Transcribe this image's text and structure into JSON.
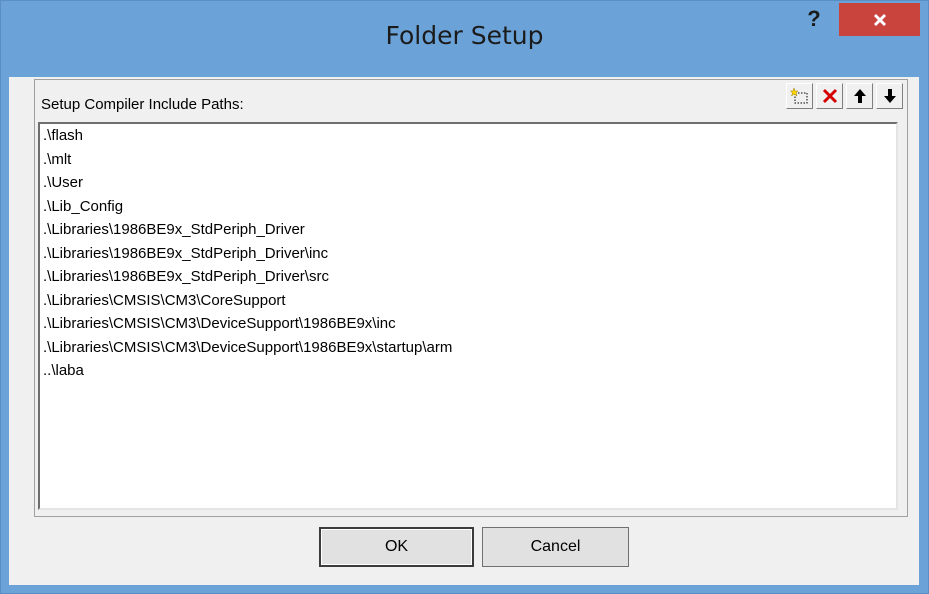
{
  "window": {
    "title": "Folder Setup",
    "help_label": "?"
  },
  "group": {
    "label": "Setup Compiler Include Paths:"
  },
  "toolbar": {
    "icons": [
      "new-folder-icon",
      "delete-icon",
      "move-up-icon",
      "move-down-icon"
    ]
  },
  "paths": [
    ".\\flash",
    ".\\mlt",
    ".\\User",
    ".\\Lib_Config",
    ".\\Libraries\\1986BE9x_StdPeriph_Driver",
    ".\\Libraries\\1986BE9x_StdPeriph_Driver\\inc",
    ".\\Libraries\\1986BE9x_StdPeriph_Driver\\src",
    ".\\Libraries\\CMSIS\\CM3\\CoreSupport",
    ".\\Libraries\\CMSIS\\CM3\\DeviceSupport\\1986BE9x\\inc",
    ".\\Libraries\\CMSIS\\CM3\\DeviceSupport\\1986BE9x\\startup\\arm",
    "..\\laba"
  ],
  "buttons": {
    "ok": "OK",
    "cancel": "Cancel"
  },
  "colors": {
    "titlebar": "#6ba3d8",
    "close": "#c9443d",
    "dialog": "#f0f0f0"
  }
}
